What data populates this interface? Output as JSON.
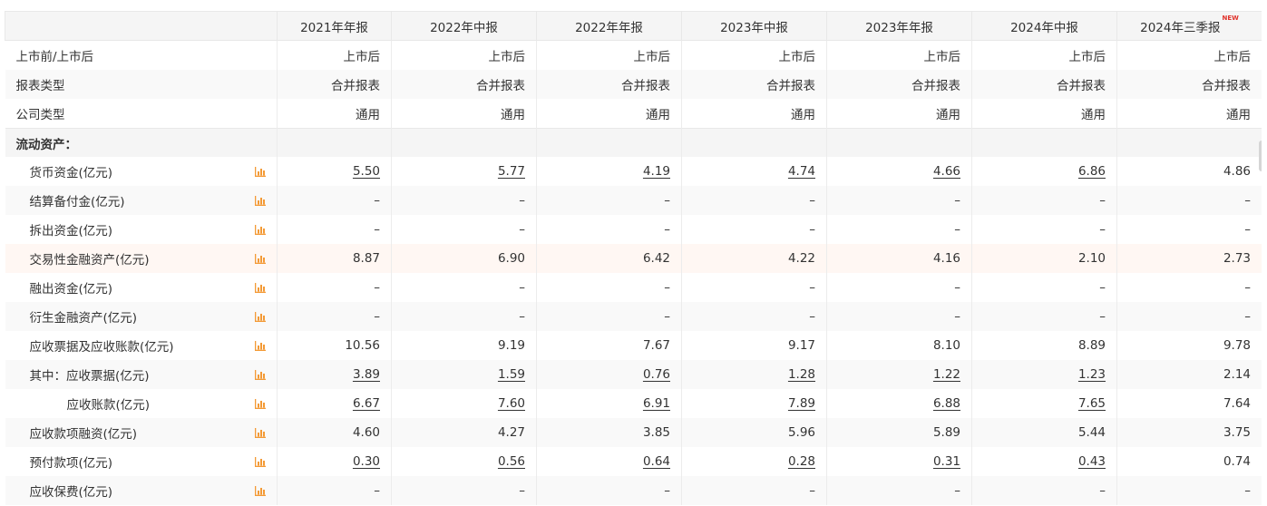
{
  "columns": [
    "2021年年报",
    "2022年中报",
    "2022年年报",
    "2023年中报",
    "2023年年报",
    "2024年中报",
    "2024年三季报"
  ],
  "new_badge": "NEW",
  "meta_rows": [
    {
      "label": "上市前/上市后",
      "values": [
        "上市后",
        "上市后",
        "上市后",
        "上市后",
        "上市后",
        "上市后",
        "上市后"
      ]
    },
    {
      "label": "报表类型",
      "values": [
        "合并报表",
        "合并报表",
        "合并报表",
        "合并报表",
        "合并报表",
        "合并报表",
        "合并报表"
      ]
    },
    {
      "label": "公司类型",
      "values": [
        "通用",
        "通用",
        "通用",
        "通用",
        "通用",
        "通用",
        "通用"
      ]
    }
  ],
  "section_label": "流动资产：",
  "rows": [
    {
      "label": "货币资金(亿元)",
      "indent": 1,
      "values": [
        "5.50",
        "5.77",
        "4.19",
        "4.74",
        "4.66",
        "6.86",
        "4.86"
      ],
      "links": [
        true,
        true,
        true,
        true,
        true,
        true,
        false
      ]
    },
    {
      "label": "结算备付金(亿元)",
      "indent": 1,
      "values": [
        "–",
        "–",
        "–",
        "–",
        "–",
        "–",
        "–"
      ],
      "links": [
        false,
        false,
        false,
        false,
        false,
        false,
        false
      ]
    },
    {
      "label": "拆出资金(亿元)",
      "indent": 1,
      "values": [
        "–",
        "–",
        "–",
        "–",
        "–",
        "–",
        "–"
      ],
      "links": [
        false,
        false,
        false,
        false,
        false,
        false,
        false
      ]
    },
    {
      "label": "交易性金融资产(亿元)",
      "indent": 1,
      "values": [
        "8.87",
        "6.90",
        "6.42",
        "4.22",
        "4.16",
        "2.10",
        "2.73"
      ],
      "links": [
        false,
        false,
        false,
        false,
        false,
        false,
        false
      ]
    },
    {
      "label": "融出资金(亿元)",
      "indent": 1,
      "values": [
        "–",
        "–",
        "–",
        "–",
        "–",
        "–",
        "–"
      ],
      "links": [
        false,
        false,
        false,
        false,
        false,
        false,
        false
      ]
    },
    {
      "label": "衍生金融资产(亿元)",
      "indent": 1,
      "values": [
        "–",
        "–",
        "–",
        "–",
        "–",
        "–",
        "–"
      ],
      "links": [
        false,
        false,
        false,
        false,
        false,
        false,
        false
      ]
    },
    {
      "label": "应收票据及应收账款(亿元)",
      "indent": 1,
      "values": [
        "10.56",
        "9.19",
        "7.67",
        "9.17",
        "8.10",
        "8.89",
        "9.78"
      ],
      "links": [
        false,
        false,
        false,
        false,
        false,
        false,
        false
      ]
    },
    {
      "label": "其中：应收票据(亿元)",
      "indent": 1,
      "values": [
        "3.89",
        "1.59",
        "0.76",
        "1.28",
        "1.22",
        "1.23",
        "2.14"
      ],
      "links": [
        true,
        true,
        true,
        true,
        true,
        true,
        false
      ]
    },
    {
      "label": "应收账款(亿元)",
      "indent": 2,
      "values": [
        "6.67",
        "7.60",
        "6.91",
        "7.89",
        "6.88",
        "7.65",
        "7.64"
      ],
      "links": [
        true,
        true,
        true,
        true,
        true,
        true,
        false
      ]
    },
    {
      "label": "应收款项融资(亿元)",
      "indent": 1,
      "values": [
        "4.60",
        "4.27",
        "3.85",
        "5.96",
        "5.89",
        "5.44",
        "3.75"
      ],
      "links": [
        false,
        false,
        false,
        false,
        false,
        false,
        false
      ]
    },
    {
      "label": "预付款项(亿元)",
      "indent": 1,
      "values": [
        "0.30",
        "0.56",
        "0.64",
        "0.28",
        "0.31",
        "0.43",
        "0.74"
      ],
      "links": [
        true,
        true,
        true,
        true,
        true,
        true,
        false
      ]
    },
    {
      "label": "应收保费(亿元)",
      "indent": 1,
      "values": [
        "–",
        "–",
        "–",
        "–",
        "–",
        "–",
        "–"
      ],
      "links": [
        false,
        false,
        false,
        false,
        false,
        false,
        false
      ]
    }
  ],
  "highlight_row": 3,
  "colors": {
    "header_bg": "#f5f5f5",
    "zebra_bg": "#f9f9f9",
    "highlight_bg": "#fff7f3",
    "chart_icon": "#f39a36",
    "new_badge": "#e0322b"
  },
  "icons": {
    "row_chart": "bar-chart-icon"
  }
}
